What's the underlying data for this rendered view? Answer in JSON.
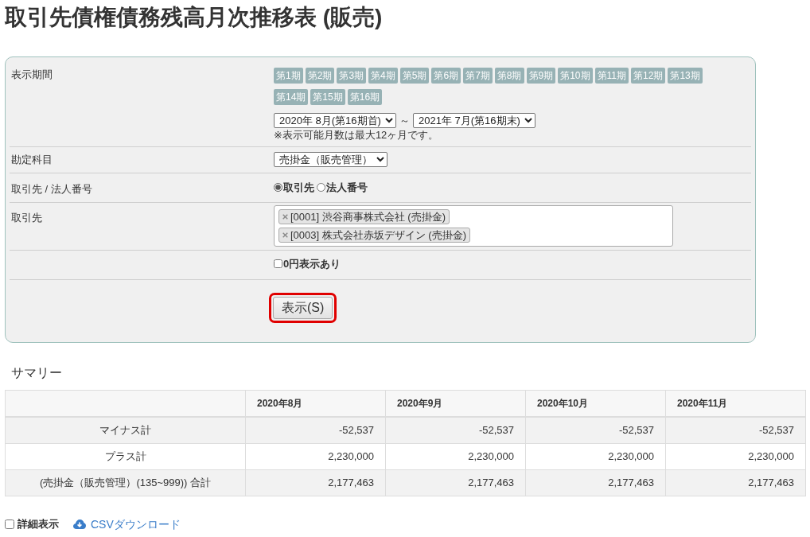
{
  "title": "取引先債権債務残高月次推移表 (販売)",
  "filter_form": {
    "rows": [
      {
        "kind": "period",
        "label": "表示期間",
        "period_buttons": [
          "第1期",
          "第2期",
          "第3期",
          "第4期",
          "第5期",
          "第6期",
          "第7期",
          "第8期",
          "第9期",
          "第10期",
          "第11期",
          "第12期",
          "第13期",
          "第14期",
          "第15期",
          "第16期"
        ],
        "from_select": {
          "value": "2020年 8月(第16期首)"
        },
        "range_separator": "～",
        "to_select": {
          "value": "2021年 7月(第16期末)"
        },
        "note": "※表示可能月数は最大12ヶ月です。"
      },
      {
        "kind": "select",
        "label": "勘定科目",
        "select": {
          "value": "売掛金（販売管理）"
        }
      },
      {
        "kind": "radio",
        "label": "取引先 / 法人番号",
        "options": [
          {
            "label": "取引先",
            "selected": true
          },
          {
            "label": "法人番号",
            "selected": false
          }
        ]
      },
      {
        "kind": "tags",
        "label": "取引先",
        "tags": [
          "[0001] 渋谷商事株式会社 (売掛金)",
          "[0003] 株式会社赤坂デザイン (売掛金)"
        ]
      },
      {
        "kind": "checkbox",
        "option": {
          "label": "0円表示あり",
          "checked": false
        }
      },
      {
        "kind": "button",
        "button": {
          "label": "表示(S)",
          "highlighted": true
        }
      }
    ]
  },
  "summary": {
    "heading": "サマリー",
    "columns": [
      "2020年8月",
      "2020年9月",
      "2020年10月",
      "2020年11月"
    ],
    "rows": [
      {
        "label": "マイナス計",
        "values": [
          "-52,537",
          "-52,537",
          "-52,537",
          "-52,537"
        ]
      },
      {
        "label": "プラス計",
        "values": [
          "2,230,000",
          "2,230,000",
          "2,230,000",
          "2,230,000"
        ]
      },
      {
        "label": "(売掛金（販売管理）(135~999)) 合計",
        "values": [
          "2,177,463",
          "2,177,463",
          "2,177,463",
          "2,177,463"
        ]
      }
    ]
  },
  "footer": {
    "detail_checkbox": {
      "label": "詳細表示",
      "checked": false
    },
    "csv_link": {
      "label": "CSVダウンロード"
    }
  }
}
